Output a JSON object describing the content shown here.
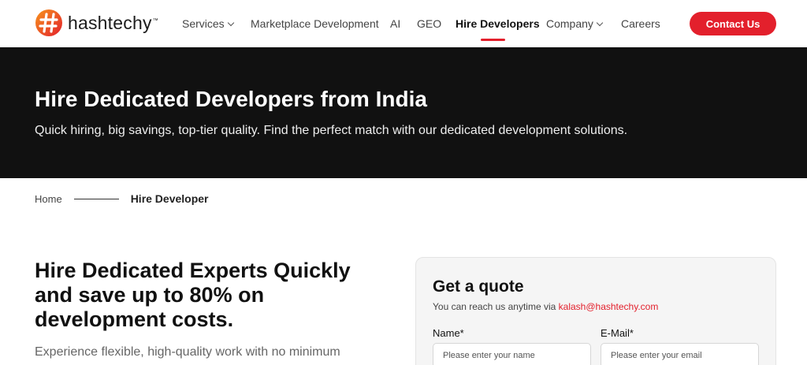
{
  "brand": {
    "name": "hashtechy",
    "tm": "™"
  },
  "nav": {
    "items": [
      {
        "label": "Services",
        "dropdown": true
      },
      {
        "label": "Marketplace Development",
        "dropdown": false
      },
      {
        "label": "AI",
        "dropdown": false
      },
      {
        "label": "GEO",
        "dropdown": false
      },
      {
        "label": "Hire Developers",
        "dropdown": false,
        "active": true
      },
      {
        "label": "Company",
        "dropdown": true
      },
      {
        "label": "Careers",
        "dropdown": false
      }
    ],
    "cta_label": "Contact Us"
  },
  "hero": {
    "title": "Hire Dedicated Developers from India",
    "subtitle": "Quick hiring, big savings, top-tier quality. Find the perfect match with our dedicated development solutions."
  },
  "breadcrumb": {
    "home": "Home",
    "current": "Hire Developer"
  },
  "main": {
    "title": "Hire Dedicated Experts Quickly and save up to 80% on development costs.",
    "description": "Experience flexible, high-quality work with no minimum"
  },
  "quote": {
    "title": "Get a quote",
    "subtitle_prefix": "You can reach us anytime via ",
    "email": "kalash@hashtechy.com",
    "name_label": "Name*",
    "name_placeholder": "Please enter your name",
    "email_label": "E-Mail*",
    "email_placeholder": "Please enter your email"
  },
  "colors": {
    "accent": "#e3202c",
    "hero_bg": "#111111",
    "card_bg": "#f5f5f5"
  },
  "icons": {
    "logo": "hashtag-logo-icon",
    "dropdown": "chevron-down-icon"
  }
}
